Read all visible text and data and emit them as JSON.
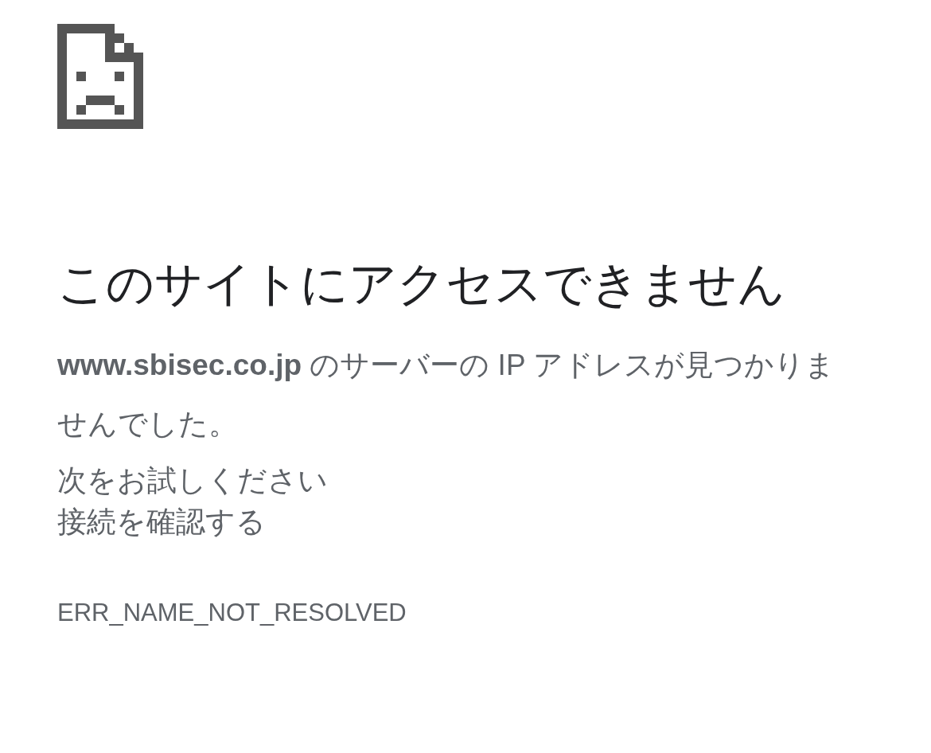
{
  "heading": "このサイトにアクセスできません",
  "message": "**www.sbisec.co.jp** のサーバーの IP アドレスが見つかりませんでした。",
  "suggestions_title": "次をお試しください",
  "suggestions": [
    "接続を確認する"
  ],
  "error_code": "ERR_NAME_NOT_RESOLVED"
}
